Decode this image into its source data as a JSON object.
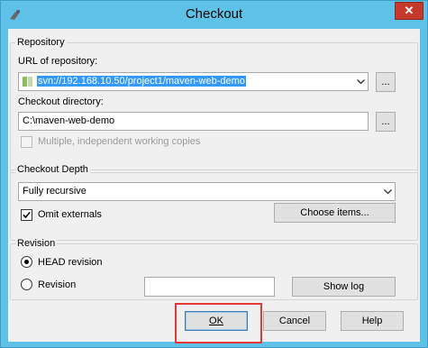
{
  "window": {
    "title": "Checkout",
    "close_glyph": "✕"
  },
  "repository": {
    "group_label": "Repository",
    "url_label": "URL of repository:",
    "url_value": "svn://192.168.10.50/project1/maven-web-demo",
    "browse_label": "...",
    "checkout_dir_label": "Checkout directory:",
    "checkout_dir_value": "C:\\maven-web-demo",
    "dir_browse_label": "...",
    "multiple_label": "Multiple, independent working copies"
  },
  "depth": {
    "group_label": "Checkout Depth",
    "selected": "Fully recursive",
    "omit_externals_label": "Omit externals",
    "omit_externals_checked": true,
    "choose_items_label": "Choose items..."
  },
  "revision": {
    "group_label": "Revision",
    "head_label": "HEAD revision",
    "revision_label": "Revision",
    "revision_value": "",
    "show_log_label": "Show log",
    "selected": "HEAD revision"
  },
  "buttons": {
    "ok": "OK",
    "cancel": "Cancel",
    "help": "Help"
  },
  "colors": {
    "highlight": "#e53935",
    "selection": "#3399ff",
    "titlebar": "#5ec2e8"
  }
}
